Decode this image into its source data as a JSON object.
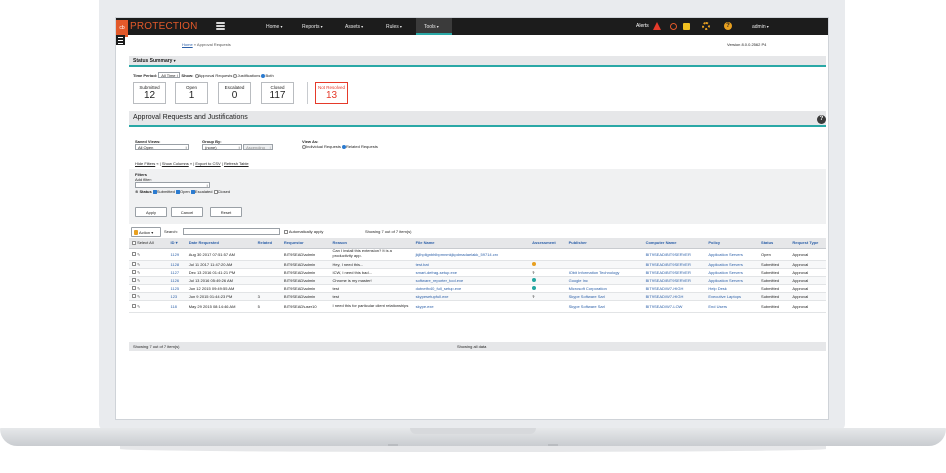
{
  "app": {
    "logo_badge": "cb",
    "logo_text": "PROTECTION",
    "version": "Version 8.0.0.2562 P4"
  },
  "nav": {
    "items": [
      {
        "label": "Home"
      },
      {
        "label": "Reports"
      },
      {
        "label": "Assets"
      },
      {
        "label": "Rules"
      },
      {
        "label": "Tools"
      }
    ],
    "alerts_label": "Alerts",
    "user": "admin"
  },
  "breadcrumb": {
    "home": "Home",
    "sep": " » ",
    "current": "Approval Requests"
  },
  "status_summary": {
    "title": "Status Summary",
    "time_period_label": "Time Period:",
    "time_period_value": "All Time",
    "show_label": "Show:",
    "show_approval": "Approval Requests",
    "show_justifications": "Justifications",
    "show_both": "Both",
    "tiles": [
      {
        "label": "Submitted",
        "value": "12"
      },
      {
        "label": "Open",
        "value": "1"
      },
      {
        "label": "Escalated",
        "value": "0"
      },
      {
        "label": "Closed",
        "value": "117"
      },
      {
        "label": "Not Resolved",
        "value": "13"
      }
    ]
  },
  "panel": {
    "title": "Approval Requests and Justifications",
    "saved_views_label": "Saved Views:",
    "saved_views_value": "All Open",
    "group_by_label": "Group By:",
    "group_by_value": "(none)",
    "group_order_value": "Ascending",
    "view_as_label": "View As:",
    "view_individual": "Individual Requests",
    "view_related": "Related Requests",
    "links": {
      "hide_filters": "Hide Filters",
      "show_columns": "Show Columns",
      "export_csv": "Export to CSV",
      "refresh": "Refresh Table"
    },
    "filters_title": "Filters",
    "add_filter_label": "Add filter:",
    "status_label": "Status",
    "status_submitted": "Submitted",
    "status_open": "Open",
    "status_escalated": "Escalated",
    "status_closed": "Closed",
    "apply": "Apply",
    "cancel": "Cancel",
    "reset": "Reset",
    "action": "Action",
    "search_label": "Search:",
    "auto_apply": "Automatically apply",
    "showing_top": "Showing 7 out of 7 item(s)"
  },
  "table": {
    "select_all": "Select All",
    "columns": [
      "ID",
      "Date Requested",
      "Related",
      "Requestor",
      "Reason",
      "File Name",
      "Assessment",
      "Publisher",
      "Computer Name",
      "Policy",
      "Status",
      "Request Type"
    ],
    "rows": [
      {
        "id": "1129",
        "date": "Aug 30 2017 07:51:57 AM",
        "related": "",
        "requestor": "BIT9SEAD\\admin",
        "reason": "Can I install this extension? It is a productivity app.",
        "file": "jkjlhpllgnbhlbpmnmkjkpdmadaelakk_59714.crx",
        "assessment": "",
        "publisher": "",
        "computer": "BIT9SEAD\\BIT9SERVER",
        "policy": "Application Servers",
        "status": "Open",
        "type": "Approval"
      },
      {
        "id": "1128",
        "date": "Jul 11 2017 11:47:20 AM",
        "related": "",
        "requestor": "BIT9SEAD\\admin",
        "reason": "Hey, I need this...",
        "file": "test.bat",
        "assessment": "warn",
        "publisher": "",
        "computer": "BIT9SEAD\\BIT9SERVER",
        "policy": "Application Servers",
        "status": "Submitted",
        "type": "Approval"
      },
      {
        "id": "1127",
        "date": "Dec 13 2016 01:41:21 PM",
        "related": "",
        "requestor": "BIT9SEAD\\admin",
        "reason": "ICW, I need this bad...",
        "file": "smart-defrag-setup.exe",
        "assessment": "?",
        "publisher": "IObit Information Technology",
        "computer": "BIT9SEAD\\BIT9SERVER",
        "policy": "Application Servers",
        "status": "Submitted",
        "type": "Approval"
      },
      {
        "id": "1126",
        "date": "Jul 13 2016 05:49:26 AM",
        "related": "",
        "requestor": "BIT9SEAD\\admin",
        "reason": "Chrome is my master!",
        "file": "software_reporter_tool.exe",
        "assessment": "ok",
        "publisher": "Google Inc",
        "computer": "BIT9SEAD\\BIT9SERVER",
        "policy": "Application Servers",
        "status": "Submitted",
        "type": "Approval"
      },
      {
        "id": "1125",
        "date": "Jun 12 2015 09:49:55 AM",
        "related": "",
        "requestor": "BIT9SEAD\\admin",
        "reason": "test",
        "file": "dotnetfx40_full_setup.exe",
        "assessment": "ok",
        "publisher": "Microsoft Corporation",
        "computer": "BIT9SEAD\\W7-HIGH",
        "policy": "Help Desk",
        "status": "Submitted",
        "type": "Approval"
      },
      {
        "id": "123",
        "date": "Jun 9 2015 01:44:23 PM",
        "related": "3",
        "requestor": "BIT9SEAD\\admin",
        "reason": "test",
        "file": "skypesetupfull.exe",
        "assessment": "?",
        "publisher": "Skype Software Sarl",
        "computer": "BIT9SEAD\\W7-HIGH",
        "policy": "Executive Laptops",
        "status": "Submitted",
        "type": "Approval"
      },
      {
        "id": "118",
        "date": "May 29 2015 08:14:46 AM",
        "related": "5",
        "requestor": "BIT9SEAD\\user10",
        "reason": "I need this for particular client relationships",
        "file": "skype.exe",
        "assessment": "",
        "publisher": "Skype Software Sarl",
        "computer": "BIT9SEAD\\W7-LOW",
        "policy": "End Users",
        "status": "Submitted",
        "type": "Approval"
      }
    ],
    "footer_left": "Showing 7 out of 7 item(s)",
    "footer_center": "Showing all data"
  },
  "colors": {
    "accent": "#2aa8a6",
    "brand": "#e2592a",
    "link": "#2b5fa8",
    "alert": "#e53a2a"
  }
}
